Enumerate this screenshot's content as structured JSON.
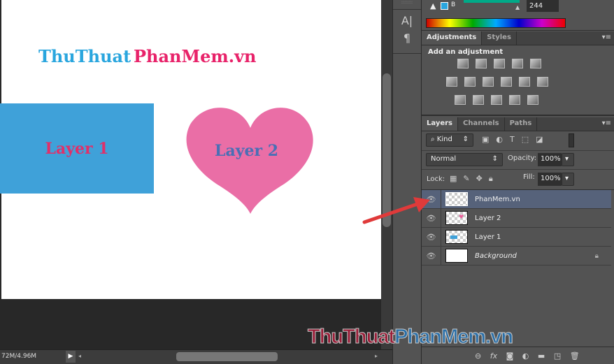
{
  "canvas": {
    "title_blue": "ThuThuat",
    "title_pink": "PhanMem.vn",
    "layer1_text": "Layer 1",
    "layer2_text": "Layer 2"
  },
  "status": {
    "doc_size": "72M/4.96M"
  },
  "color": {
    "channel": "B",
    "value": "244"
  },
  "adjustments": {
    "tabs": [
      "Adjustments",
      "Styles"
    ],
    "heading": "Add an adjustment"
  },
  "layers_panel": {
    "tabs": [
      "Layers",
      "Channels",
      "Paths"
    ],
    "filter": "Kind",
    "blend_mode": "Normal",
    "opacity_label": "Opacity:",
    "opacity": "100%",
    "lock_label": "Lock:",
    "fill_label": "Fill:",
    "fill": "100%",
    "layers": [
      {
        "name": "PhanMem.vn",
        "selected": true
      },
      {
        "name": "Layer 2"
      },
      {
        "name": "Layer 1"
      },
      {
        "name": "Background",
        "locked": true
      }
    ]
  },
  "watermark": {
    "part1": "ThuThuat",
    "part2": "PhanMem.vn"
  },
  "colors": {
    "blue": "#3fa1d9",
    "pink": "#ea6ea6",
    "title_pink": "#e8236a",
    "arrow": "#e03a3a"
  }
}
